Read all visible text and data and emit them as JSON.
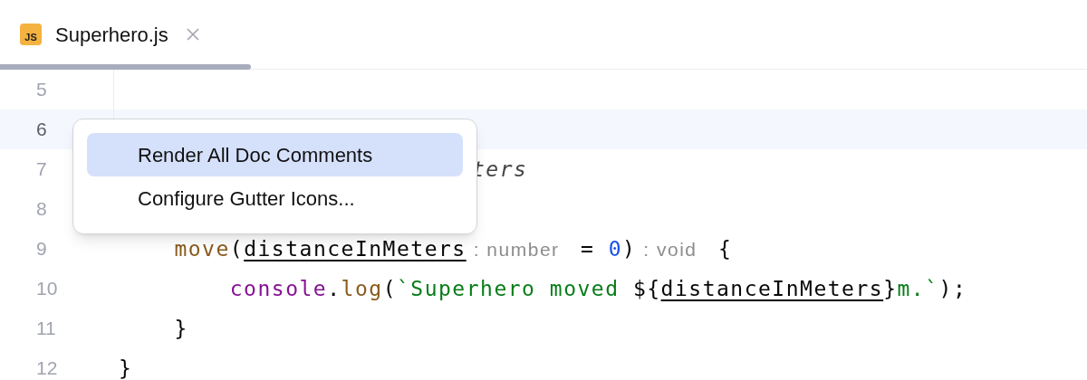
{
  "tabs": [
    {
      "label": "Superhero.js",
      "icon": "JS",
      "selected": true
    }
  ],
  "editor": {
    "lines": [
      {
        "number": "5",
        "current": false
      },
      {
        "number": "6",
        "current": true
      },
      {
        "number": "7",
        "current": false,
        "tokens": [
          {
            "kind": "comment-tail",
            "text": "ters"
          }
        ]
      },
      {
        "number": "8",
        "current": false
      },
      {
        "number": "9",
        "current": false,
        "tokens": [
          {
            "kind": "method",
            "text": "    move"
          },
          {
            "kind": "plain",
            "text": "("
          },
          {
            "kind": "param",
            "text": "distanceInMeters"
          },
          {
            "kind": "hint",
            "text": ": number"
          },
          {
            "kind": "plain",
            "text": " = "
          },
          {
            "kind": "number",
            "text": "0"
          },
          {
            "kind": "plain",
            "text": ")"
          },
          {
            "kind": "hint",
            "text": ": void"
          },
          {
            "kind": "plain",
            "text": " {"
          }
        ]
      },
      {
        "number": "10",
        "current": false,
        "tokens": [
          {
            "kind": "global",
            "text": "        console"
          },
          {
            "kind": "member-call",
            "text": ".log"
          },
          {
            "kind": "plain",
            "text": "("
          },
          {
            "kind": "string",
            "text": "`Superhero moved "
          },
          {
            "kind": "plain",
            "text": "${"
          },
          {
            "kind": "param",
            "text": "distanceInMeters"
          },
          {
            "kind": "plain",
            "text": "}"
          },
          {
            "kind": "string",
            "text": "m.`"
          },
          {
            "kind": "plain",
            "text": ");"
          }
        ]
      },
      {
        "number": "11",
        "current": false,
        "tokens": [
          {
            "kind": "plain",
            "text": "    }"
          }
        ]
      },
      {
        "number": "12",
        "current": false,
        "tokens": [
          {
            "kind": "plain",
            "text": "}"
          }
        ]
      }
    ]
  },
  "context_menu": {
    "items": [
      {
        "label": "Render All Doc Comments",
        "selected": true
      },
      {
        "label": "Configure Gutter Icons...",
        "selected": false
      }
    ]
  }
}
